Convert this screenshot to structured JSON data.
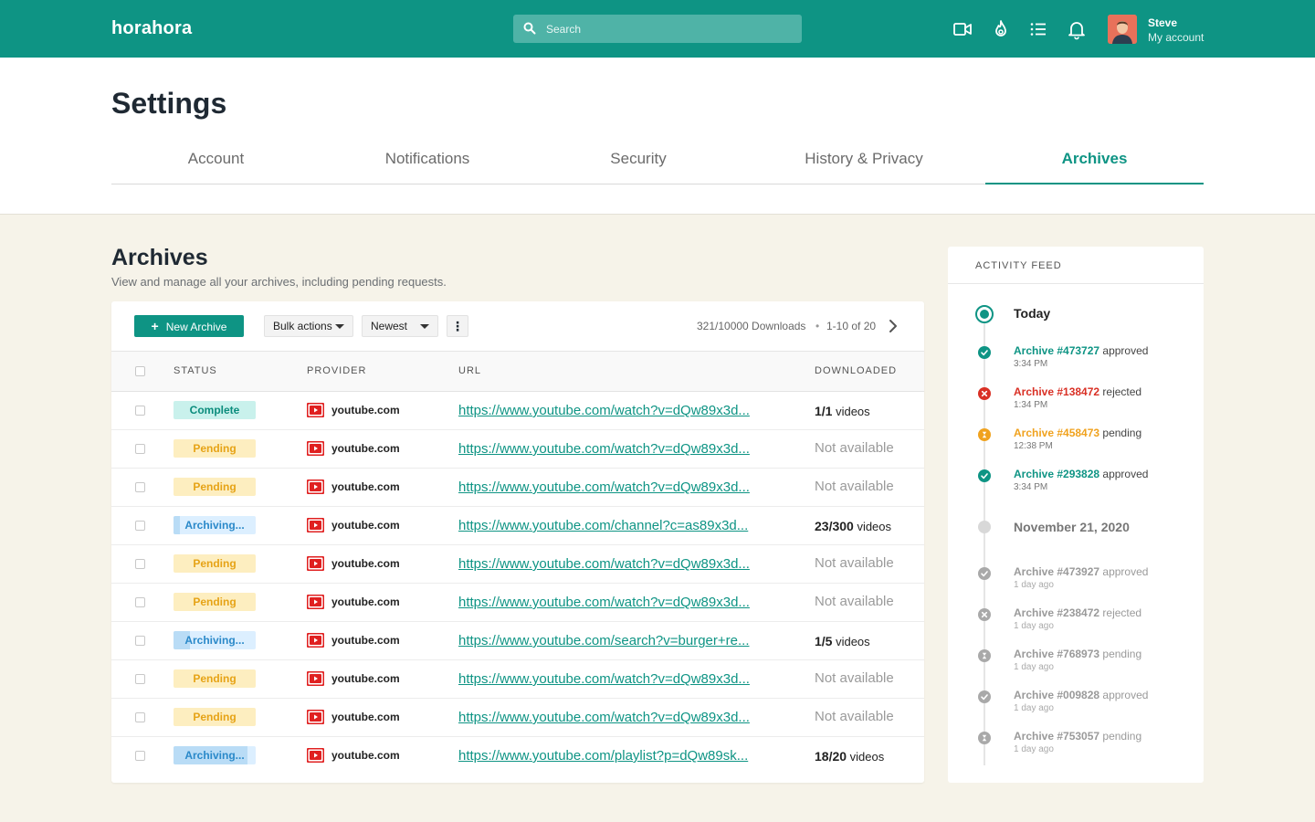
{
  "app": {
    "name": "horahora"
  },
  "search": {
    "placeholder": "Search"
  },
  "topbar": {
    "icons": [
      "video-camera-icon",
      "fire-icon",
      "list-icon",
      "bell-icon"
    ],
    "user_name": "Steve",
    "user_sub": "My account"
  },
  "page": {
    "title": "Settings"
  },
  "tabs": [
    {
      "label": "Account",
      "active": false
    },
    {
      "label": "Notifications",
      "active": false
    },
    {
      "label": "Security",
      "active": false
    },
    {
      "label": "History & Privacy",
      "active": false
    },
    {
      "label": "Archives",
      "active": true
    }
  ],
  "archives": {
    "title": "Archives",
    "subtitle": "View and manage all your archives, including pending requests.",
    "new_label": "New Archive",
    "bulk_label": "Bulk actions",
    "sort_label": "Newest",
    "downloads": "321/10000 Downloads",
    "separator": "•",
    "range": "1-10 of 20",
    "columns": {
      "status": "STATUS",
      "provider": "PROVIDER",
      "url": "URL",
      "downloaded": "DOWNLOADED"
    },
    "rows": [
      {
        "status": "Complete",
        "kind": "complete",
        "provider": "youtube.com",
        "url": "https://www.youtube.com/watch?v=dQw89x3d...",
        "dl_count": "1/1",
        "dl_unit": " videos"
      },
      {
        "status": "Pending",
        "kind": "pending",
        "provider": "youtube.com",
        "url": "https://www.youtube.com/watch?v=dQw89x3d...",
        "dl_na": "Not available"
      },
      {
        "status": "Pending",
        "kind": "pending",
        "provider": "youtube.com",
        "url": "https://www.youtube.com/watch?v=dQw89x3d...",
        "dl_na": "Not available"
      },
      {
        "status": "Archiving...",
        "kind": "archiving",
        "progress": 0.08,
        "provider": "youtube.com",
        "url": "https://www.youtube.com/channel?c=as89x3d...",
        "dl_count": "23/300",
        "dl_unit": " videos"
      },
      {
        "status": "Pending",
        "kind": "pending",
        "provider": "youtube.com",
        "url": "https://www.youtube.com/watch?v=dQw89x3d...",
        "dl_na": "Not available"
      },
      {
        "status": "Pending",
        "kind": "pending",
        "provider": "youtube.com",
        "url": "https://www.youtube.com/watch?v=dQw89x3d...",
        "dl_na": "Not available"
      },
      {
        "status": "Archiving...",
        "kind": "archiving",
        "progress": 0.2,
        "provider": "youtube.com",
        "url": "https://www.youtube.com/search?v=burger+re...",
        "dl_count": "1/5",
        "dl_unit": " videos"
      },
      {
        "status": "Pending",
        "kind": "pending",
        "provider": "youtube.com",
        "url": "https://www.youtube.com/watch?v=dQw89x3d...",
        "dl_na": "Not available"
      },
      {
        "status": "Pending",
        "kind": "pending",
        "provider": "youtube.com",
        "url": "https://www.youtube.com/watch?v=dQw89x3d...",
        "dl_na": "Not available"
      },
      {
        "status": "Archiving...",
        "kind": "archiving",
        "progress": 0.9,
        "provider": "youtube.com",
        "url": "https://www.youtube.com/playlist?p=dQw89sk...",
        "dl_count": "18/20",
        "dl_unit": " videos"
      }
    ]
  },
  "feed": {
    "title": "ACTIVITY FEED",
    "today_label": "Today",
    "today_events": [
      {
        "id": "Archive #473727",
        "action": " approved",
        "time": "3:34 PM",
        "status": "approved",
        "color": "#0e9484"
      },
      {
        "id": "Archive #138472",
        "action": " rejected",
        "time": "1:34 PM",
        "status": "rejected",
        "color": "#d93025"
      },
      {
        "id": "Archive #458473",
        "action": " pending",
        "time": "12:38 PM",
        "status": "pending",
        "color": "#f0a21e"
      },
      {
        "id": "Archive #293828",
        "action": " approved",
        "time": "3:34 PM",
        "status": "approved",
        "color": "#0e9484"
      }
    ],
    "past_label": "November 21, 2020",
    "past_events": [
      {
        "id": "Archive #473927",
        "action": " approved",
        "time": "1 day ago",
        "status": "approved"
      },
      {
        "id": "Archive #238472",
        "action": " rejected",
        "time": "1 day ago",
        "status": "rejected"
      },
      {
        "id": "Archive #768973",
        "action": " pending",
        "time": "1 day ago",
        "status": "pending"
      },
      {
        "id": "Archive #009828",
        "action": " approved",
        "time": "1 day ago",
        "status": "approved"
      },
      {
        "id": "Archive #753057",
        "action": " pending",
        "time": "1 day ago",
        "status": "pending"
      }
    ]
  }
}
